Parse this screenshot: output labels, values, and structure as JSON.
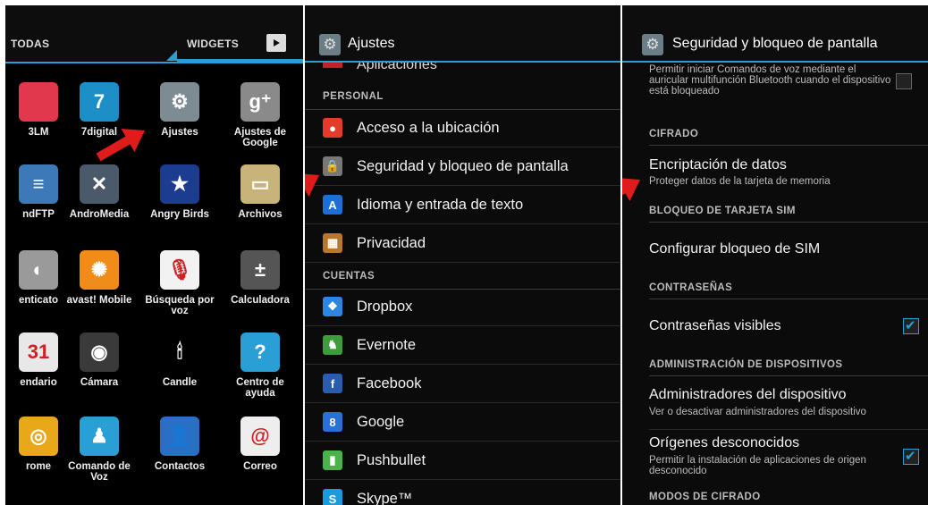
{
  "panel1": {
    "tabs": {
      "todas": "TODAS",
      "widgets": "WIDGETS"
    },
    "apps": [
      {
        "label": "3LM",
        "icon": "flower-icon",
        "color": "#e2384d"
      },
      {
        "label": "7digital",
        "icon": "seven-digital-icon",
        "color": "#1d8fc6",
        "glyph": "7"
      },
      {
        "label": "Ajustes",
        "icon": "settings-gear-icon",
        "color": "#7d8b93",
        "glyph": "⚙"
      },
      {
        "label": "Ajustes de Google",
        "icon": "google-settings-icon",
        "color": "#8a8a8a",
        "glyph": "g⁺"
      },
      {
        "label": "ndFTP",
        "icon": "ftp-icon",
        "color": "#3d78b8",
        "glyph": "≡"
      },
      {
        "label": "AndroMedia",
        "icon": "andromedia-icon",
        "color": "#4a5a6a",
        "glyph": "✕"
      },
      {
        "label": "Angry Birds",
        "icon": "angry-birds-icon",
        "color": "#1c3d8f",
        "glyph": "★"
      },
      {
        "label": "Archivos",
        "icon": "archive-box-icon",
        "color": "#c8b37a",
        "glyph": "▭"
      },
      {
        "label": "enticato",
        "icon": "authenticator-icon",
        "color": "#9a9a9a",
        "glyph": "◐"
      },
      {
        "label": "avast! Mobile",
        "icon": "avast-icon",
        "color": "#f08c1a",
        "glyph": "✺"
      },
      {
        "label": "Búsqueda por voz",
        "icon": "voice-search-icon",
        "color": "#f2f2f2",
        "glyph": "🎙"
      },
      {
        "label": "Calculadora",
        "icon": "calculator-icon",
        "color": "#555",
        "glyph": "±"
      },
      {
        "label": "endario",
        "icon": "calendar-icon",
        "color": "#e8e8e8",
        "glyph": "31"
      },
      {
        "label": "Cámara",
        "icon": "camera-icon",
        "color": "#3a3a3a",
        "glyph": "◉"
      },
      {
        "label": "Candle",
        "icon": "candle-icon",
        "color": "#000",
        "glyph": "🕯"
      },
      {
        "label": "Centro de ayuda",
        "icon": "help-icon",
        "color": "#2a9fd6",
        "glyph": "?"
      },
      {
        "label": "rome",
        "icon": "chrome-icon",
        "color": "#e8a81a",
        "glyph": "◎"
      },
      {
        "label": "Comando de Voz",
        "icon": "voice-command-icon",
        "color": "#2a9fd6",
        "glyph": "♟"
      },
      {
        "label": "Contactos",
        "icon": "contacts-icon",
        "color": "#2a6fc6",
        "glyph": "👤"
      },
      {
        "label": "Correo",
        "icon": "mail-icon",
        "color": "#eee",
        "glyph": "@"
      }
    ]
  },
  "panel2": {
    "title": "Ajustes",
    "partial_item": "Aplicaciones",
    "section_personal": "PERSONAL",
    "personal_items": [
      {
        "label": "Acceso a la ubicación",
        "icon": "location-icon",
        "color": "#e53b2c",
        "glyph": "●"
      },
      {
        "label": "Seguridad y bloqueo de pantalla",
        "icon": "lock-icon",
        "color": "#777",
        "glyph": "🔒"
      },
      {
        "label": "Idioma y entrada de texto",
        "icon": "language-icon",
        "color": "#1c6fd6",
        "glyph": "A"
      },
      {
        "label": "Privacidad",
        "icon": "privacy-icon",
        "color": "#b8772c",
        "glyph": "▦"
      }
    ],
    "section_cuentas": "CUENTAS",
    "account_items": [
      {
        "label": "Dropbox",
        "icon": "dropbox-icon",
        "color": "#2a86e0",
        "glyph": "❖"
      },
      {
        "label": "Evernote",
        "icon": "evernote-icon",
        "color": "#3f9c3a",
        "glyph": "♞"
      },
      {
        "label": "Facebook",
        "icon": "facebook-icon",
        "color": "#2a5db0",
        "glyph": "f"
      },
      {
        "label": "Google",
        "icon": "google-icon",
        "color": "#2a6fd6",
        "glyph": "8"
      },
      {
        "label": "Pushbullet",
        "icon": "pushbullet-icon",
        "color": "#4ab34a",
        "glyph": "▮"
      },
      {
        "label": "Skype™",
        "icon": "skype-icon",
        "color": "#1a9be0",
        "glyph": "S"
      }
    ]
  },
  "panel3": {
    "title": "Seguridad y bloqueo de pantalla",
    "voice_cmd_text": "Permitir iniciar Comandos de voz mediante el auricular multifunción Bluetooth cuando el dispositivo está bloqueado",
    "section_cifrado": "CIFRADO",
    "encrypt_title": "Encriptación de datos",
    "encrypt_sub": "Proteger datos de la tarjeta de memoria",
    "section_sim": "BLOQUEO DE TARJETA SIM",
    "sim_title": "Configurar bloqueo de SIM",
    "section_pass": "CONTRASEÑAS",
    "pass_title": "Contraseñas visibles",
    "section_admin": "ADMINISTRACIÓN DE DISPOSITIVOS",
    "admin_title": "Administradores del dispositivo",
    "admin_sub": "Ver o desactivar administradores del dispositivo",
    "unknown_title": "Orígenes desconocidos",
    "unknown_sub": "Permitir la instalación de aplicaciones de origen desconocido",
    "section_modes": "MODOS DE CIFRADO"
  },
  "colors": {
    "accent": "#2a9fd6",
    "arrow": "#e01b1b"
  }
}
